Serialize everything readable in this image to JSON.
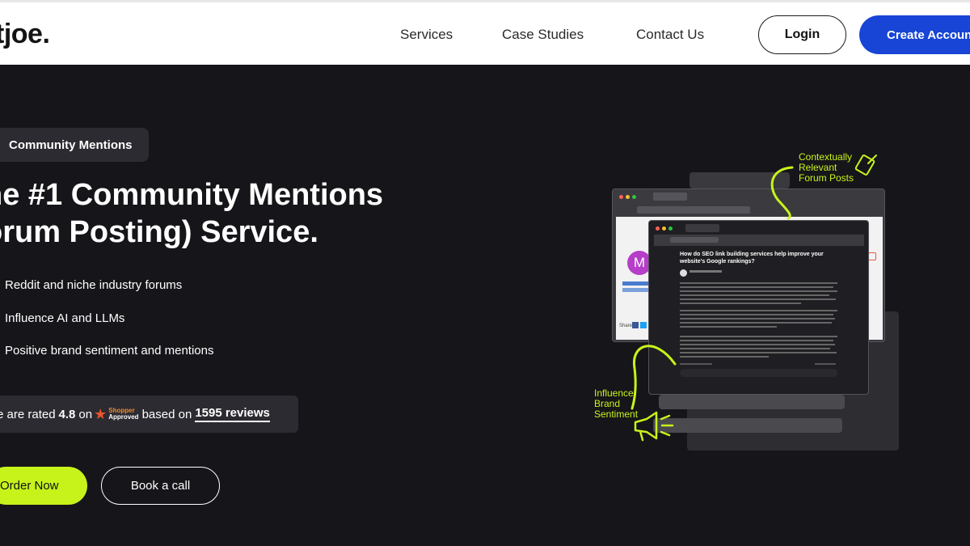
{
  "header": {
    "logo": "tjoe.",
    "nav": [
      "Services",
      "Case Studies",
      "Contact Us"
    ],
    "login_label": "Login",
    "create_label": "Create Account"
  },
  "hero": {
    "badge": "Community Mentions",
    "headline_line1": "he #1 Community Mentions",
    "headline_line2": "orum Posting) Service.",
    "features": [
      "Reddit and niche industry forums",
      "Influence AI and LLMs",
      "Positive brand sentiment and mentions"
    ],
    "rating": {
      "prefix": "e are rated",
      "score": "4.8",
      "on": "on",
      "badge_line1": "Shopper",
      "badge_line2": "Approved",
      "based": "based on",
      "reviews": "1595 reviews"
    },
    "order_label": "Order Now",
    "call_label": "Book a call"
  },
  "illustration": {
    "annotation_top": [
      "Contextually",
      "Relevant",
      "Forum Posts"
    ],
    "annotation_bottom": [
      "Influence",
      "Brand",
      "Sentiment"
    ],
    "post_title": "How do SEO link building services help improve your website's Google rankings?",
    "avatar_letter": "M",
    "share_label": "Share",
    "colors": {
      "accent": "#c7f31b",
      "brand": "#1845d6"
    },
    "icons": [
      "pencil-note-icon",
      "megaphone-icon"
    ]
  }
}
